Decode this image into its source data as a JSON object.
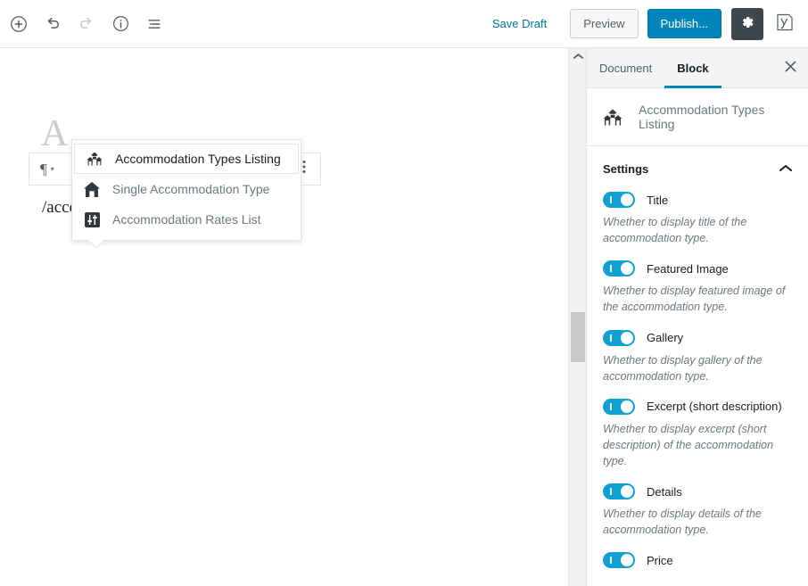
{
  "topbar": {
    "icons": {
      "add_block": "plus-circle-icon",
      "undo": "undo-icon",
      "redo": "redo-icon",
      "info": "info-circle-icon",
      "list_view": "list-view-icon",
      "settings": "gear-icon",
      "yoast": "yoast-seo-icon"
    },
    "save_draft_label": "Save Draft",
    "preview_label": "Preview",
    "publish_label": "Publish...",
    "publish_color": "#0085ba",
    "gear_color": "#40464d"
  },
  "editor": {
    "title_placeholder": "A",
    "block_toolbar": {
      "paragraph_glyph": "¶",
      "caret_glyph": "▾",
      "more_icon": "more-vertical-icon"
    },
    "typed_text": "/accom"
  },
  "autocomplete": {
    "items": [
      {
        "label": "Accommodation Types Listing",
        "icon": "houses-cluster-icon",
        "selected": true
      },
      {
        "label": "Single Accommodation Type",
        "icon": "house-icon",
        "selected": false
      },
      {
        "label": "Accommodation Rates List",
        "icon": "sliders-icon",
        "selected": false
      }
    ]
  },
  "scrollbar": {
    "up_arrow_icon": "chevron-up-icon",
    "thumb_color": "#c9c9c9"
  },
  "sidebar": {
    "tabs": [
      {
        "label": "Document",
        "active": false
      },
      {
        "label": "Block",
        "active": true
      }
    ],
    "close_icon": "close-icon",
    "active_tab_color": "#0085ba",
    "block": {
      "icon": "houses-cluster-icon",
      "title": "Accommodation Types Listing"
    },
    "panel": {
      "title": "Settings",
      "chevron_icon": "chevron-up-icon",
      "expanded": true,
      "toggle_on_color": "#11a0d2",
      "settings": [
        {
          "label": "Title",
          "enabled": true,
          "description": "Whether to display title of the accommodation type."
        },
        {
          "label": "Featured Image",
          "enabled": true,
          "description": "Whether to display featured image of the accommodation type."
        },
        {
          "label": "Gallery",
          "enabled": true,
          "description": "Whether to display gallery of the accommodation type."
        },
        {
          "label": "Excerpt (short description)",
          "enabled": true,
          "description": "Whether to display excerpt (short description) of the accommodation type."
        },
        {
          "label": "Details",
          "enabled": true,
          "description": "Whether to display details of the accommodation type."
        },
        {
          "label": "Price",
          "enabled": true,
          "description": ""
        }
      ]
    }
  }
}
